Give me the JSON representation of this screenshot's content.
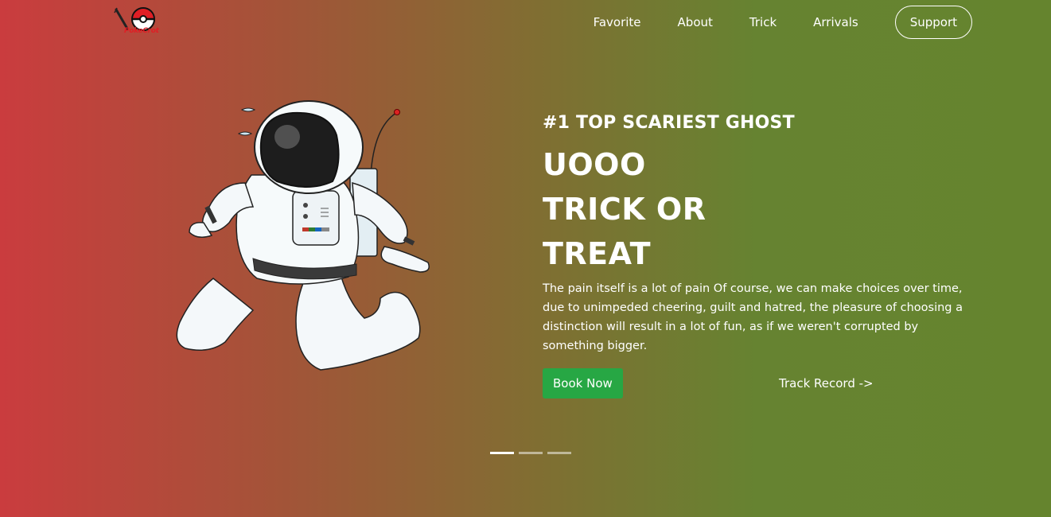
{
  "brand": {
    "logo_text": "PokeCrot"
  },
  "nav": {
    "items": [
      "Favorite",
      "About",
      "Trick",
      "Arrivals"
    ],
    "support_label": "Support"
  },
  "hero": {
    "eyebrow": "#1 TOP SCARIEST GHOST",
    "headline": [
      "UOOO",
      "TRICK OR",
      "TREAT"
    ],
    "description": "The pain itself is a lot of pain Of course, we can make choices over time, due to unimpeded cheering, guilt and hatred, the pleasure of choosing a distinction will result in a lot of fun, as if we weren't corrupted by something bigger.",
    "book_label": "Book Now",
    "track_label": "Track Record ->"
  },
  "carousel": {
    "slides": 3,
    "active_index": 0
  },
  "colors": {
    "gradient_left": "#ca3c3e",
    "gradient_right": "#65842e",
    "book_button": "#27a744"
  }
}
